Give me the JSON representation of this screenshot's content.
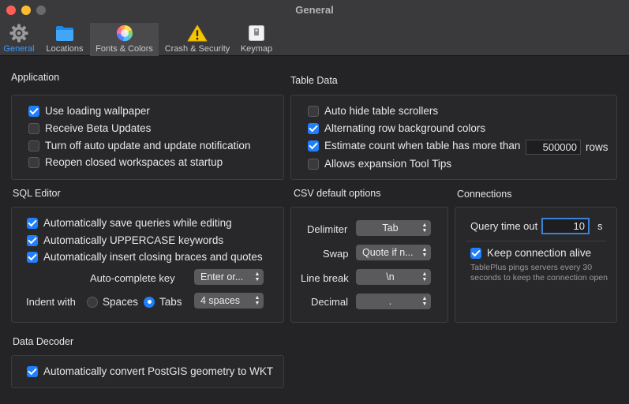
{
  "window": {
    "title": "General"
  },
  "toolbar": {
    "items": [
      {
        "label": "General",
        "icon": "gear-icon"
      },
      {
        "label": "Locations",
        "icon": "folder-icon"
      },
      {
        "label": "Fonts & Colors",
        "icon": "color-wheel-icon"
      },
      {
        "label": "Crash & Security",
        "icon": "warning-icon"
      },
      {
        "label": "Keymap",
        "icon": "keyboard-key-icon"
      }
    ]
  },
  "application": {
    "title": "Application",
    "items": [
      {
        "label": "Use loading wallpaper",
        "checked": true
      },
      {
        "label": "Receive Beta Updates",
        "checked": false
      },
      {
        "label": "Turn off auto update and update notification",
        "checked": false
      },
      {
        "label": "Reopen closed workspaces at startup",
        "checked": false
      }
    ]
  },
  "table_data": {
    "title": "Table Data",
    "items": [
      {
        "label": "Auto hide table scrollers",
        "checked": false
      },
      {
        "label": "Alternating row background colors",
        "checked": true
      },
      {
        "label": "Estimate count when table has more than",
        "checked": true
      },
      {
        "label": "Allows expansion Tool Tips",
        "checked": false
      }
    ],
    "row_count": "500000",
    "rows_suffix": "rows"
  },
  "sql_editor": {
    "title": "SQL Editor",
    "items": [
      {
        "label": "Automatically save queries while editing",
        "checked": true
      },
      {
        "label": "Automatically UPPERCASE keywords",
        "checked": true
      },
      {
        "label": "Automatically insert closing braces and quotes",
        "checked": true
      }
    ],
    "autocomplete_label": "Auto-complete key",
    "autocomplete_value": "Enter or...",
    "indent_label": "Indent with",
    "indent_options": [
      "Spaces",
      "Tabs"
    ],
    "indent_selected": "Tabs",
    "indent_size_value": "4 spaces"
  },
  "csv": {
    "title": "CSV default options",
    "fields": [
      {
        "label": "Delimiter",
        "value": "Tab"
      },
      {
        "label": "Swap",
        "value": "Quote if n..."
      },
      {
        "label": "Line break",
        "value": "\\n"
      },
      {
        "label": "Decimal",
        "value": "."
      }
    ]
  },
  "connections": {
    "title": "Connections",
    "timeout_label": "Query time out",
    "timeout_value": "10",
    "timeout_unit": "s",
    "keep_alive_label": "Keep connection alive",
    "keep_alive_checked": true,
    "note": "TablePlus pings servers every 30 seconds to keep the connection open"
  },
  "data_decoder": {
    "title": "Data Decoder",
    "items": [
      {
        "label": "Automatically convert PostGIS geometry to WKT",
        "checked": true
      }
    ]
  },
  "colors": {
    "accent": "#1f7fff",
    "selected_tab_label": "#3d9bff",
    "background": "#242426",
    "toolbar": "#3a3a3c"
  }
}
